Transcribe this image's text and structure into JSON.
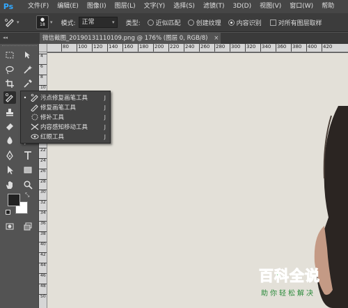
{
  "app": {
    "logo": "Ps"
  },
  "menubar": {
    "items": [
      "文件(F)",
      "编辑(E)",
      "图像(I)",
      "图层(L)",
      "文字(Y)",
      "选择(S)",
      "滤镜(T)",
      "3D(D)",
      "视图(V)",
      "窗口(W)",
      "帮助"
    ]
  },
  "options": {
    "brush_size": "18",
    "mode_label": "模式:",
    "mode_value": "正常",
    "type_label": "类型:",
    "type_options": [
      "近似匹配",
      "创建纹理",
      "内容识别"
    ],
    "type_selected": "内容识别",
    "sample_all_label": "对所有图层取样"
  },
  "document": {
    "tab_title": "微信截图_20190131110109.png @ 176% (图层 0, RGB/8)",
    "close_symbol": "×"
  },
  "ruler": {
    "top_labels": [
      "80",
      "100",
      "120",
      "140",
      "160",
      "180",
      "200",
      "220",
      "240",
      "260",
      "280",
      "300",
      "320",
      "340",
      "360",
      "380",
      "400",
      "420"
    ],
    "left_labels": [
      "4",
      "6",
      "8",
      "10",
      "12",
      "14",
      "16",
      "18",
      "20",
      "22",
      "24",
      "26",
      "28",
      "30",
      "32",
      "34",
      "36",
      "38",
      "40",
      "42",
      "44",
      "46",
      "48",
      "50"
    ]
  },
  "flyout": {
    "items": [
      {
        "label": "污点修复画笔工具",
        "key": "J",
        "icon": "spot-healing-brush-icon",
        "selected": true
      },
      {
        "label": "修复画笔工具",
        "key": "J",
        "icon": "healing-brush-icon",
        "selected": false
      },
      {
        "label": "修补工具",
        "key": "J",
        "icon": "patch-icon",
        "selected": false
      },
      {
        "label": "内容感知移动工具",
        "key": "J",
        "icon": "content-aware-move-icon",
        "selected": false
      },
      {
        "label": "红眼工具",
        "key": "J",
        "icon": "red-eye-icon",
        "selected": false
      }
    ],
    "bullet": "•"
  },
  "watermark": {
    "title": "百科全说",
    "subtitle": "助你轻松解决"
  },
  "colors": {
    "foreground": "#222222",
    "background": "#ffffff",
    "canvas": "#e3e0d8",
    "accent": "#1fa83a"
  }
}
